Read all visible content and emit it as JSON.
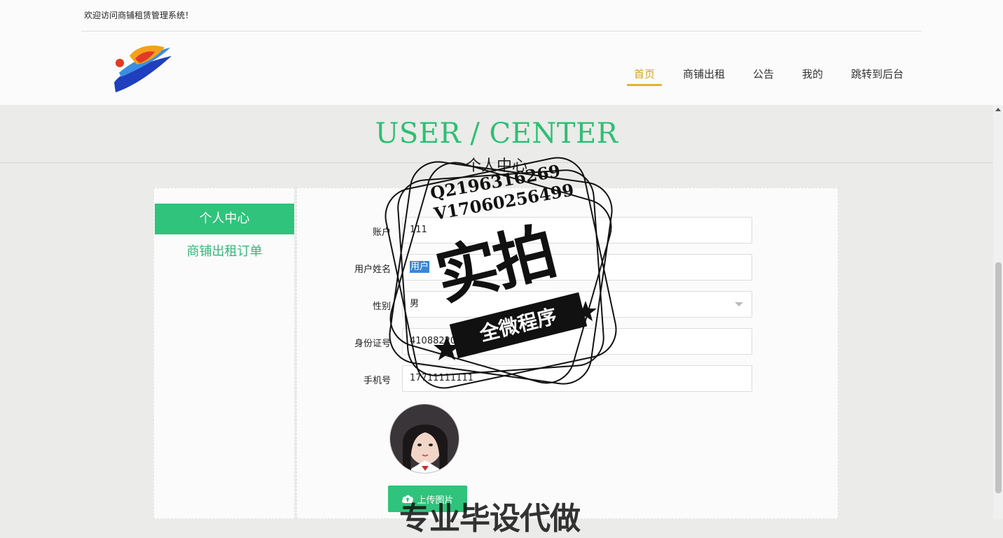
{
  "header": {
    "welcome": "欢迎访问商铺租赁管理系统！",
    "nav": [
      {
        "label": "首页",
        "active": true
      },
      {
        "label": "商铺出租",
        "active": false
      },
      {
        "label": "公告",
        "active": false
      },
      {
        "label": "我的",
        "active": false
      },
      {
        "label": "跳转到后台",
        "active": false
      }
    ]
  },
  "hero": {
    "title": "USER / CENTER",
    "subtitle": "个人中心"
  },
  "sidebar": {
    "items": [
      {
        "label": "个人中心",
        "active": true
      },
      {
        "label": "商铺出租订单",
        "active": false
      }
    ]
  },
  "form": {
    "account_label": "账户",
    "account_value": "111",
    "username_label": "用户姓名",
    "username_value": "用户",
    "gender_label": "性别",
    "gender_value": "男",
    "idcard_label": "身份证号",
    "idcard_value": "41088220011",
    "phone_label": "手机号",
    "phone_value": "17711111111",
    "upload_label": "上传图片"
  },
  "watermark": {
    "qq": "Q2196316269",
    "wechat": "V17060256499",
    "big": "实拍",
    "ribbon": "全微程序",
    "bottom": "专业毕设代做"
  },
  "colors": {
    "accent_green": "#2fc37b",
    "nav_active": "#d9a21b",
    "nav_underline": "#e2b628"
  }
}
